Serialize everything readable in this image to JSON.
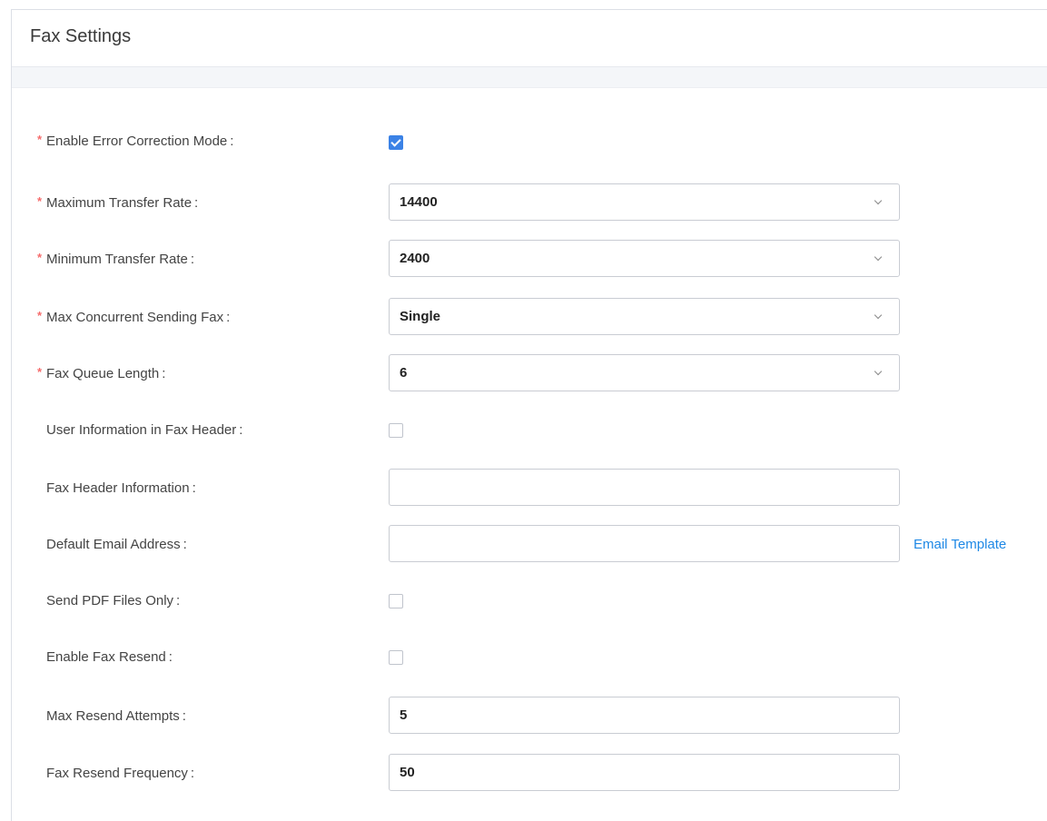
{
  "header": {
    "title": "Fax Settings"
  },
  "fields": {
    "ecm": {
      "label": "Enable Error Correction Mode",
      "required": "*",
      "checked": true
    },
    "max_rate": {
      "label": "Maximum Transfer Rate",
      "required": "*",
      "value": "14400"
    },
    "min_rate": {
      "label": "Minimum Transfer Rate",
      "required": "*",
      "value": "2400"
    },
    "max_concurrent": {
      "label": "Max Concurrent Sending Fax",
      "required": "*",
      "value": "Single"
    },
    "queue_length": {
      "label": "Fax Queue Length",
      "required": "*",
      "value": "6"
    },
    "user_info": {
      "label": "User Information in Fax Header",
      "checked": false
    },
    "header_info": {
      "label": "Fax Header Information",
      "value": ""
    },
    "default_email": {
      "label": "Default Email Address",
      "value": "",
      "link": "Email Template"
    },
    "pdf_only": {
      "label": "Send PDF Files Only",
      "checked": false
    },
    "resend": {
      "label": "Enable Fax Resend",
      "checked": false
    },
    "resend_attempts": {
      "label": "Max Resend Attempts",
      "value": "5"
    },
    "resend_frequency": {
      "label": "Fax Resend Frequency",
      "value": "50"
    }
  },
  "colon": ":",
  "colors": {
    "accent": "#3b82e6",
    "required": "#f56c6c",
    "link": "#1e88e5"
  }
}
